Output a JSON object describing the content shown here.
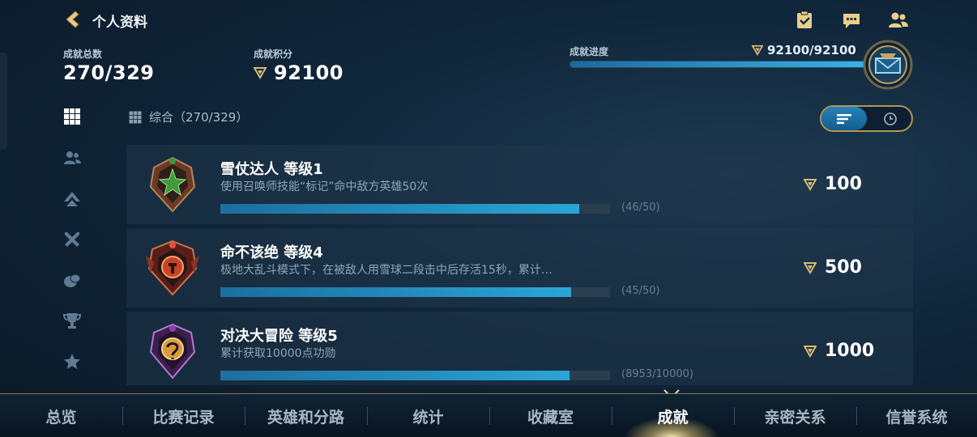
{
  "header": {
    "title": "个人资料",
    "icons": [
      "task-icon",
      "chat-icon",
      "friends-icon"
    ]
  },
  "stats": {
    "total_label": "成就总数",
    "total_value": "270/329",
    "points_label": "成就积分",
    "points_value": "92100",
    "progress_label": "成就进度",
    "progress_value": "92100/92100",
    "progress_fraction": 1.0
  },
  "rail": {
    "icons": [
      "grid-icon",
      "friends-icon",
      "rank-icon",
      "crossed-swords-icon",
      "snowball-icon",
      "trophy-icon",
      "star-icon"
    ]
  },
  "category": {
    "title": "综合（270/329）"
  },
  "view_toggle": {
    "icons": [
      "list-view-icon",
      "clock-icon"
    ],
    "active": "list"
  },
  "achievements": [
    {
      "title": "雪仗达人  等级1",
      "description": "使用召唤师技能“标记”命中敌方英雄50次",
      "progress_text": "(46/50)",
      "progress_fraction": 0.92,
      "points": "100",
      "badge_icon": "bronze-crest-badge-icon",
      "badge_color": "#3e9a3c"
    },
    {
      "title": "命不该绝  等级4",
      "description": "极地大乱斗模式下，在被敌人用雪球二段击中后存活15秒，累计…",
      "progress_text": "(45/50)",
      "progress_fraction": 0.9,
      "points": "500",
      "badge_icon": "red-crest-badge-icon",
      "badge_color": "#c9422a"
    },
    {
      "title": "对决大冒险  等级5",
      "description": "累计获取10000点功勋",
      "progress_text": "(8953/10000)",
      "progress_fraction": 0.8953,
      "points": "1000",
      "badge_icon": "purple-crest-badge-icon",
      "badge_color": "#8a3fb0"
    }
  ],
  "bottom_nav": {
    "items": [
      "总览",
      "比赛记录",
      "英雄和分路",
      "统计",
      "收藏室",
      "成就",
      "亲密关系",
      "信誉系统"
    ],
    "active_index": 5
  },
  "colors": {
    "accent_blue": "#2aa5d6",
    "gold": "#b39556",
    "background": "#10263a"
  }
}
